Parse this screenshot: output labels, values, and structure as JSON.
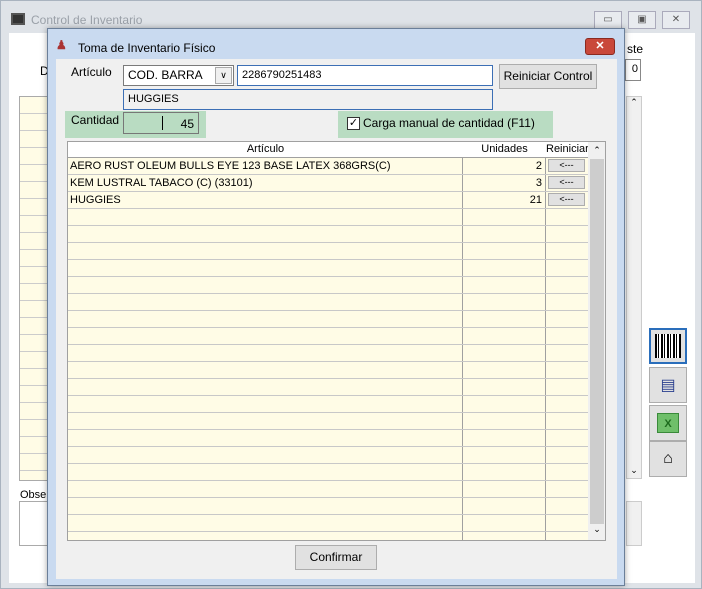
{
  "outer": {
    "title": "Control de Inventario",
    "label_d": "D",
    "label_ste": "ste",
    "value_0": "0",
    "label_obs": "Obser"
  },
  "dialog": {
    "title": "Toma de Inventario Físico",
    "articulo_label": "Artículo",
    "search_type": "COD. BARRA",
    "barcode_value": "2286790251483",
    "reset_button": "Reiniciar Control",
    "description": "HUGGIES",
    "cantidad_label": "Cantidad",
    "cantidad_value": "45",
    "manual_checkbox_label": "Carga manual de cantidad (F11)",
    "manual_checked": true,
    "grid": {
      "headers": [
        "Artículo",
        "Unidades",
        "Reiniciar"
      ],
      "rows": [
        {
          "articulo": "AERO RUST OLEUM BULLS EYE 123 BASE LATEX 368GRS(C)",
          "unidades": "2",
          "reiniciar": "<---"
        },
        {
          "articulo": "KEM LUSTRAL TABACO (C) (33101)",
          "unidades": "3",
          "reiniciar": "<---"
        },
        {
          "articulo": "HUGGIES",
          "unidades": "21",
          "reiniciar": "<---"
        }
      ]
    },
    "confirm_button": "Confirmar"
  }
}
